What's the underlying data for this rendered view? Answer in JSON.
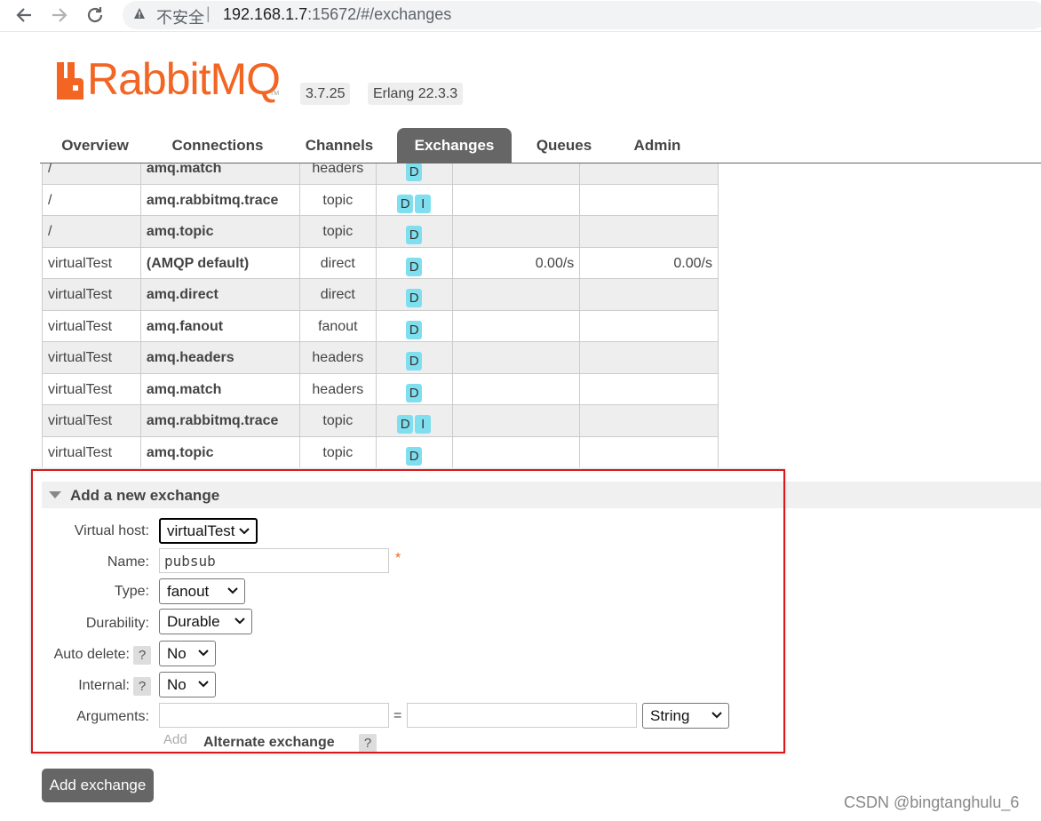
{
  "browser": {
    "back_icon": "back-arrow-icon",
    "forward_icon": "forward-arrow-icon",
    "reload_icon": "reload-icon",
    "insecure_label": "不安全",
    "separator": "|",
    "url_host": "192.168.1.7",
    "url_rest": ":15672/#/exchanges"
  },
  "header": {
    "logo_text": "RabbitMQ",
    "logo_tm": "TM",
    "version": "3.7.25",
    "erlang": "Erlang 22.3.3",
    "brand_color": "#f26523"
  },
  "tabs": [
    {
      "label": "Overview"
    },
    {
      "label": "Connections"
    },
    {
      "label": "Channels"
    },
    {
      "label": "Exchanges",
      "active": true
    },
    {
      "label": "Queues"
    },
    {
      "label": "Admin"
    }
  ],
  "exchanges": {
    "rows": [
      {
        "vhost": "/",
        "name": "amq.match",
        "type": "headers",
        "features": [
          "D"
        ],
        "rate_in": "",
        "rate_out": ""
      },
      {
        "vhost": "/",
        "name": "amq.rabbitmq.trace",
        "type": "topic",
        "features": [
          "D",
          "I"
        ],
        "rate_in": "",
        "rate_out": ""
      },
      {
        "vhost": "/",
        "name": "amq.topic",
        "type": "topic",
        "features": [
          "D"
        ],
        "rate_in": "",
        "rate_out": ""
      },
      {
        "vhost": "virtualTest",
        "name": "(AMQP default)",
        "type": "direct",
        "features": [
          "D"
        ],
        "rate_in": "0.00/s",
        "rate_out": "0.00/s"
      },
      {
        "vhost": "virtualTest",
        "name": "amq.direct",
        "type": "direct",
        "features": [
          "D"
        ],
        "rate_in": "",
        "rate_out": ""
      },
      {
        "vhost": "virtualTest",
        "name": "amq.fanout",
        "type": "fanout",
        "features": [
          "D"
        ],
        "rate_in": "",
        "rate_out": ""
      },
      {
        "vhost": "virtualTest",
        "name": "amq.headers",
        "type": "headers",
        "features": [
          "D"
        ],
        "rate_in": "",
        "rate_out": ""
      },
      {
        "vhost": "virtualTest",
        "name": "amq.match",
        "type": "headers",
        "features": [
          "D"
        ],
        "rate_in": "",
        "rate_out": ""
      },
      {
        "vhost": "virtualTest",
        "name": "amq.rabbitmq.trace",
        "type": "topic",
        "features": [
          "D",
          "I"
        ],
        "rate_in": "",
        "rate_out": ""
      },
      {
        "vhost": "virtualTest",
        "name": "amq.topic",
        "type": "topic",
        "features": [
          "D"
        ],
        "rate_in": "",
        "rate_out": ""
      }
    ]
  },
  "add_form": {
    "title": "Add a new exchange",
    "virtual_host_label": "Virtual host:",
    "virtual_host_value": "virtualTest",
    "name_label": "Name:",
    "name_value": "pubsub",
    "required_mark": "*",
    "type_label": "Type:",
    "type_value": "fanout",
    "durability_label": "Durability:",
    "durability_value": "Durable",
    "auto_delete_label": "Auto delete:",
    "auto_delete_value": "No",
    "internal_label": "Internal:",
    "internal_value": "No",
    "help_mark": "?",
    "arguments_label": "Arguments:",
    "arg_key_value": "",
    "arg_equals": "=",
    "arg_value_value": "",
    "arg_type_value": "String",
    "add_link": "Add",
    "alternate_exchange": "Alternate exchange",
    "submit_label": "Add exchange"
  },
  "watermark": "CSDN @bingtanghulu_6"
}
